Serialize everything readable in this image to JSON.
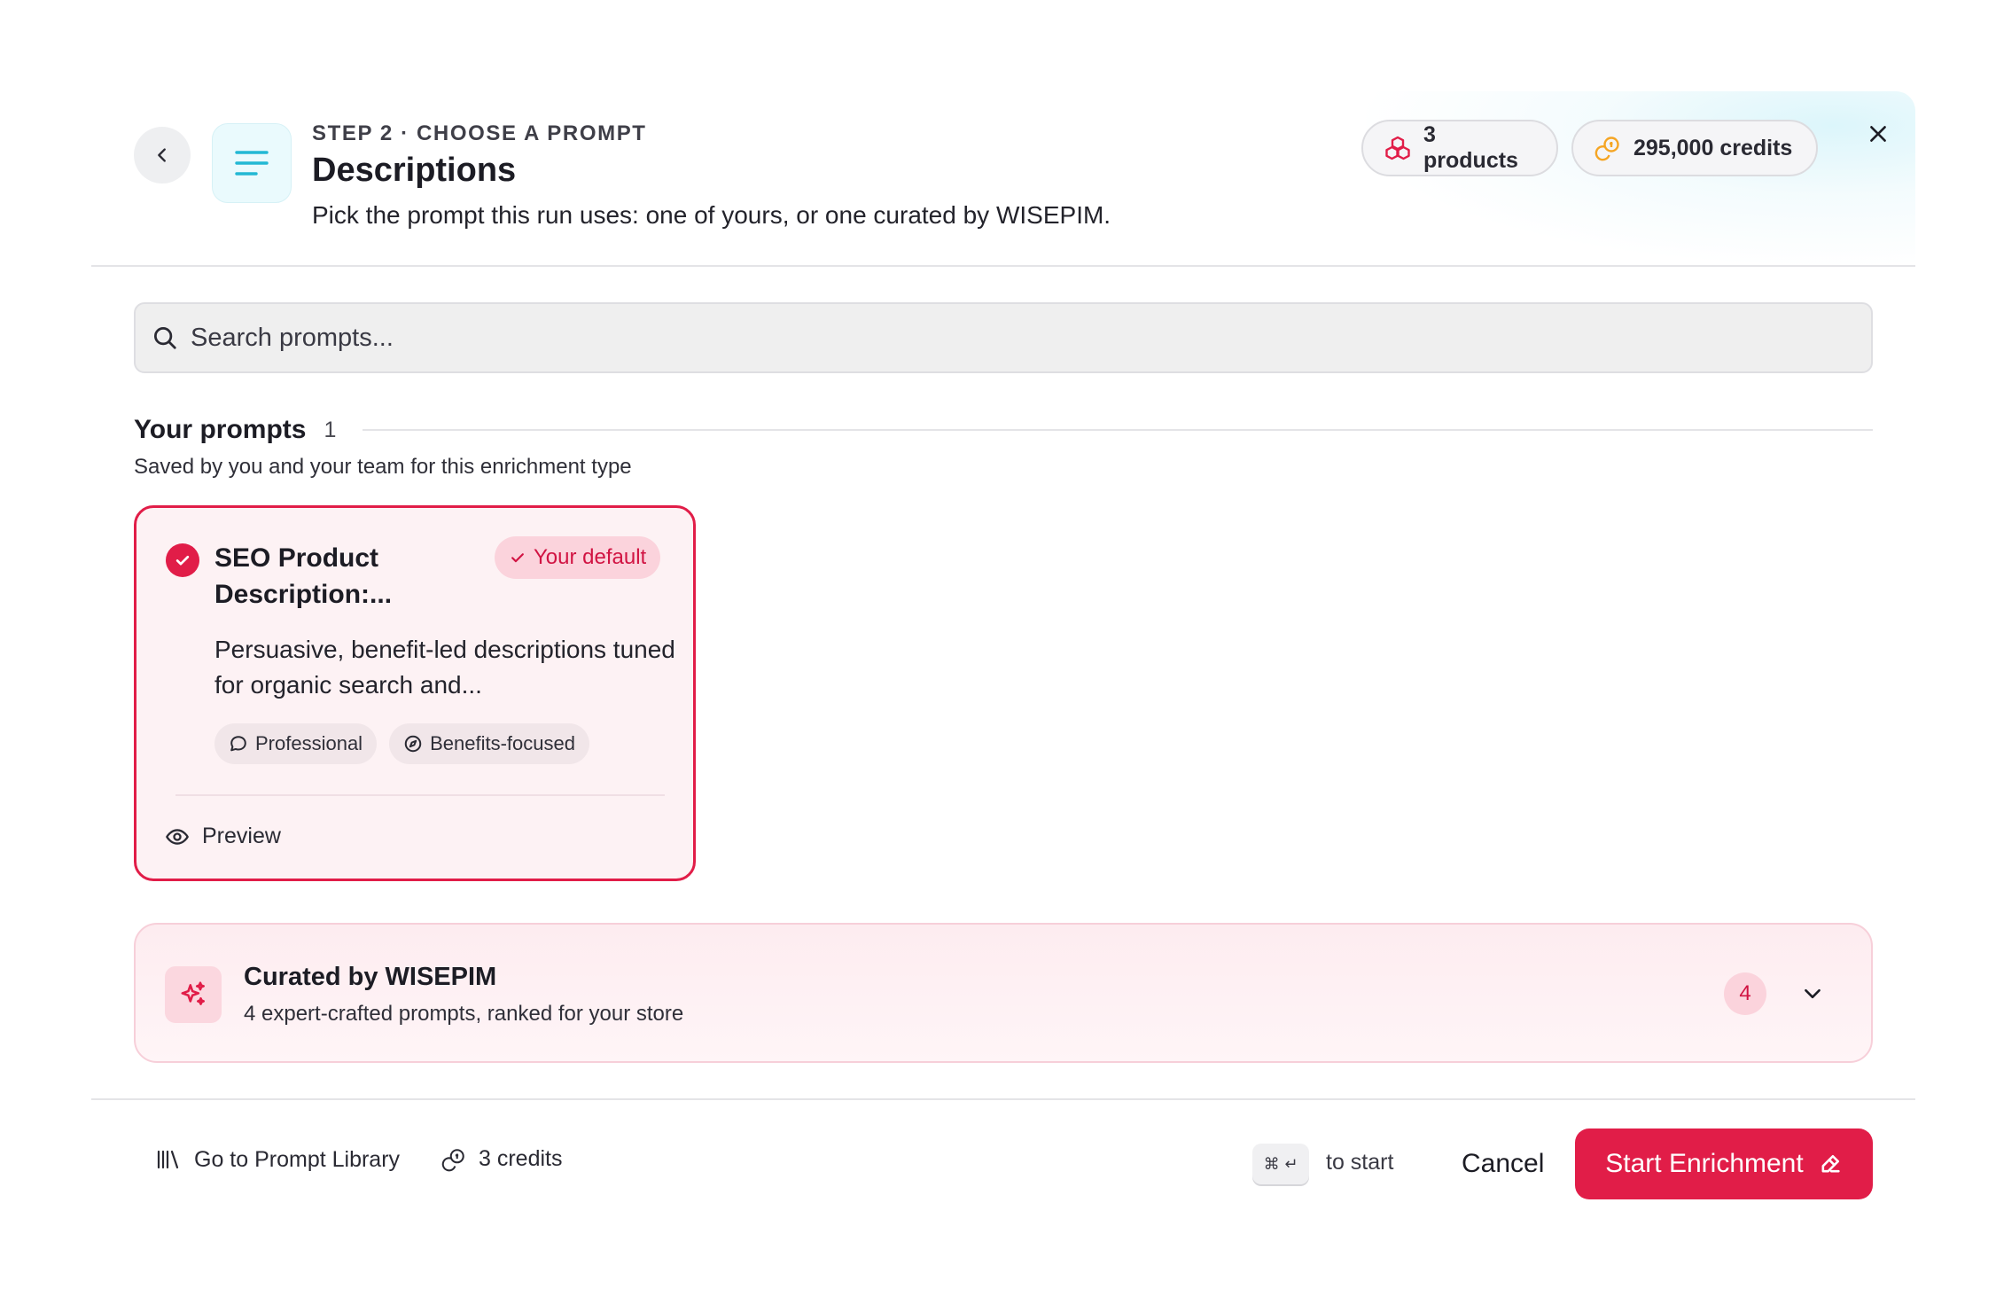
{
  "header": {
    "step_label": "STEP 2 · CHOOSE A PROMPT",
    "title": "Descriptions",
    "subtitle": "Pick the prompt this run uses: one of yours, or one curated by WISEPIM.",
    "products_pill": "3 products",
    "credits_pill": "295,000 credits",
    "icons": {
      "back": "chevron-left-icon",
      "type": "text-lines-icon",
      "products": "cubes-icon",
      "credits": "coins-icon",
      "close": "close-icon"
    }
  },
  "search": {
    "placeholder": "Search prompts...",
    "value": ""
  },
  "your_prompts": {
    "title": "Your prompts",
    "count": "1",
    "description": "Saved by you and your team for this enrichment type",
    "cards": [
      {
        "title": "SEO Product Description:...",
        "selected": true,
        "badge": "Your default",
        "description": "Persuasive, benefit-led descriptions tuned for organic search and...",
        "tags": [
          "Professional",
          "Benefits-focused"
        ],
        "preview_label": "Preview"
      }
    ]
  },
  "curated": {
    "title": "Curated by WISEPIM",
    "subtitle": "4 expert-crafted prompts, ranked for your store",
    "count": "4",
    "expanded": false
  },
  "footer": {
    "library_link": "Go to Prompt Library",
    "credits_cost": "3 credits",
    "shortcut_keys": "⌘ ↵",
    "shortcut_label": "to start",
    "cancel_label": "Cancel",
    "start_label": "Start Enrichment"
  },
  "colors": {
    "accent": "#e11d48",
    "accent_soft": "#fbd3dc",
    "card_bg": "#fdf2f4",
    "teal_icon": "#22b8d4",
    "credits_icon": "#f5a524"
  }
}
